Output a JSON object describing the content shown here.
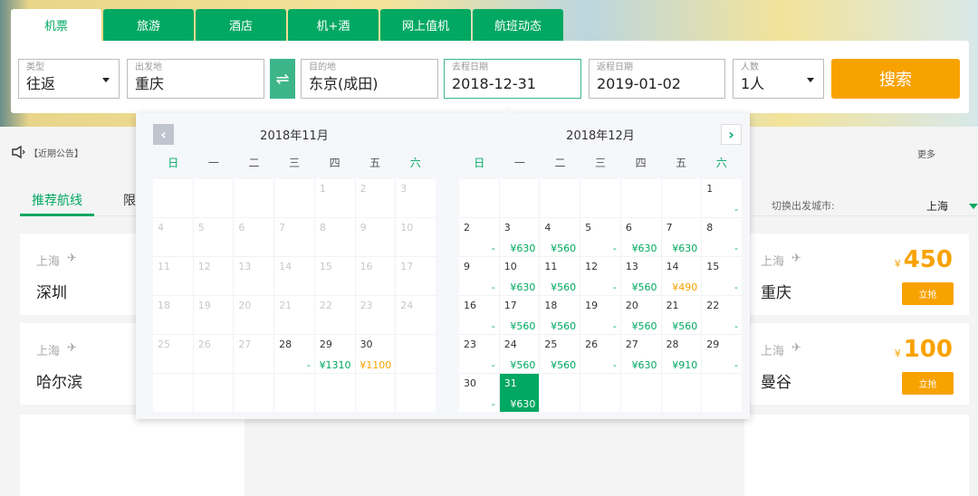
{
  "tabs": [
    "机票",
    "旅游",
    "酒店",
    "机+酒",
    "网上值机",
    "航班动态"
  ],
  "form": {
    "type": {
      "label": "类型",
      "value": "往返"
    },
    "from": {
      "label": "出发地",
      "value": "重庆"
    },
    "swap_icon": "⇌",
    "to": {
      "label": "目的地",
      "value": "东京(成田)"
    },
    "depart": {
      "label": "去程日期",
      "value": "2018-12-31"
    },
    "return": {
      "label": "返程日期",
      "value": "2019-01-02"
    },
    "pax": {
      "label": "人数",
      "value": "1人"
    },
    "search": "搜索"
  },
  "notice": {
    "label": "【近期公告】",
    "more": "更多"
  },
  "routes": {
    "tabs": [
      "推荐航线",
      "限"
    ],
    "switch_label": "切换出发城市:",
    "switch_city": "上海"
  },
  "cards": [
    {
      "from": "上海",
      "to": "深圳"
    },
    {
      "from": "上海",
      "to": "哈尔滨"
    },
    {
      "from": "上海",
      "to": "重庆",
      "currency": "¥",
      "price": "450",
      "buy": "立抢"
    },
    {
      "from": "上海",
      "to": "曼谷",
      "currency": "¥",
      "price": "100",
      "buy": "立抢"
    }
  ],
  "calendar": {
    "weekdays": [
      "日",
      "一",
      "二",
      "三",
      "四",
      "五",
      "六"
    ],
    "months": [
      {
        "title": "2018年11月",
        "offset": 4,
        "days": 30,
        "first_active": 28,
        "prices": {
          "28": "-",
          "29": "¥1310",
          "30": "¥1100"
        },
        "low": [
          "30"
        ]
      },
      {
        "title": "2018年12月",
        "offset": 6,
        "days": 31,
        "first_active": 1,
        "selected": "31",
        "prices": {
          "1": "-",
          "2": "-",
          "3": "¥630",
          "4": "¥560",
          "5": "-",
          "6": "¥630",
          "7": "¥630",
          "8": "-",
          "9": "-",
          "10": "¥630",
          "11": "¥560",
          "12": "-",
          "13": "¥560",
          "14": "¥490",
          "15": "-",
          "16": "-",
          "17": "¥560",
          "18": "¥560",
          "19": "-",
          "20": "¥560",
          "21": "¥560",
          "22": "-",
          "23": "-",
          "24": "¥560",
          "25": "¥560",
          "26": "-",
          "27": "¥630",
          "28": "¥910",
          "29": "-",
          "30": "-",
          "31": "¥630"
        },
        "low": [
          "14"
        ]
      }
    ]
  }
}
